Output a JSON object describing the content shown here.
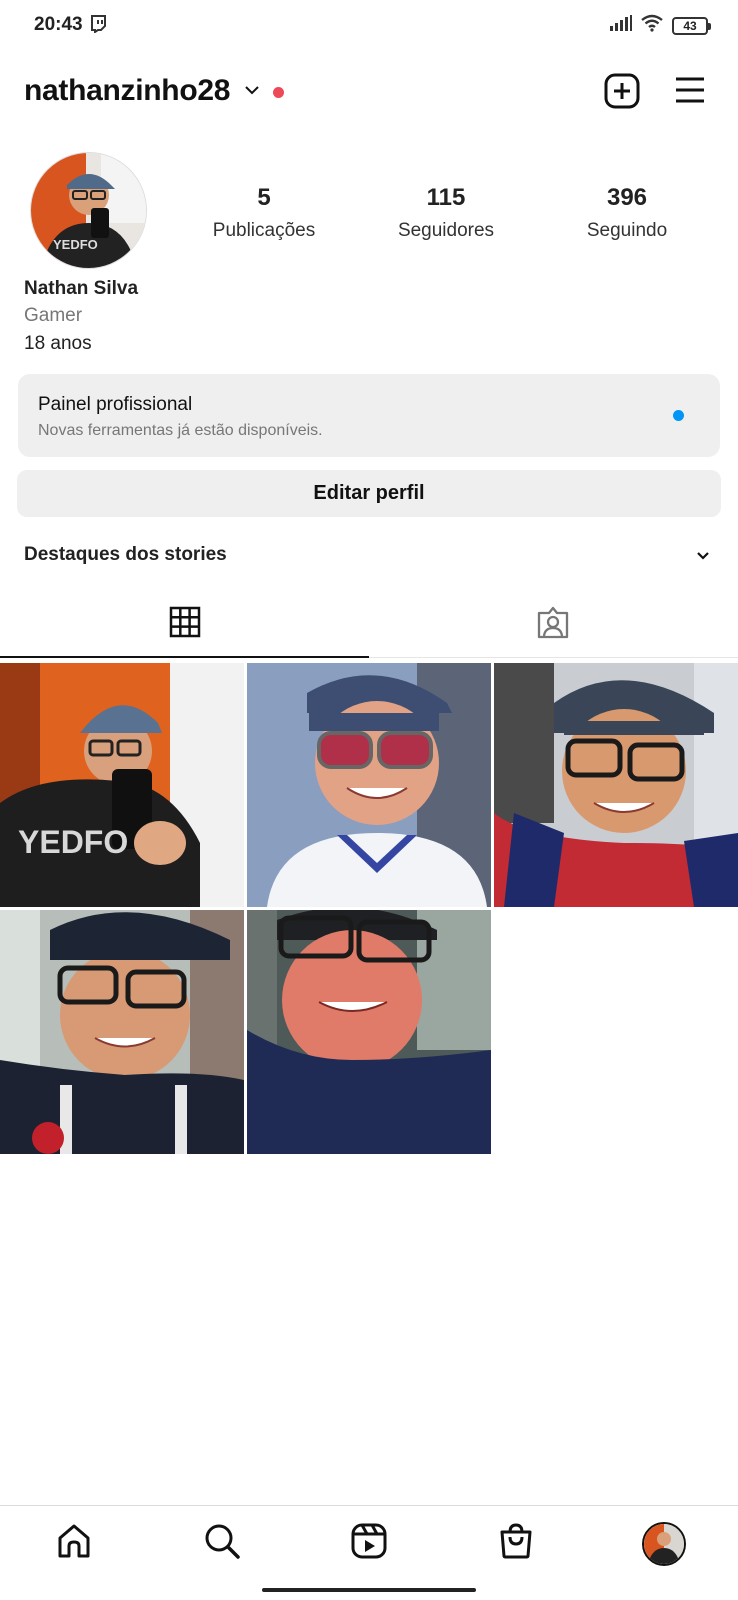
{
  "status_bar": {
    "time": "20:43",
    "battery": "43",
    "icons": [
      "twitch-icon",
      "signal-icon",
      "wifi-icon",
      "battery-icon"
    ]
  },
  "header": {
    "username": "nathanzinho28",
    "icons": [
      "chevron-down-icon",
      "notification-dot",
      "add-post-icon",
      "menu-icon"
    ]
  },
  "profile": {
    "stats": [
      {
        "value": "5",
        "label": "Publicações"
      },
      {
        "value": "115",
        "label": "Seguidores"
      },
      {
        "value": "396",
        "label": "Seguindo"
      }
    ],
    "name": "Nathan Silva",
    "category": "Gamer",
    "bio": "18 anos"
  },
  "pro_panel": {
    "title": "Painel profissional",
    "subtitle": "Novas ferramentas já estão disponíveis."
  },
  "edit_profile_label": "Editar perfil",
  "highlights_label": "Destaques dos stories",
  "tabs": [
    {
      "icon": "grid-icon",
      "active": true
    },
    {
      "icon": "tagged-icon",
      "active": false
    }
  ],
  "posts_count": 5,
  "bottom_nav": [
    "home-icon",
    "search-icon",
    "reels-icon",
    "shop-icon",
    "profile-avatar"
  ],
  "colors": {
    "accent_blue": "#0095f6",
    "notification_red": "#ed4956",
    "panel_bg": "#efefef"
  }
}
